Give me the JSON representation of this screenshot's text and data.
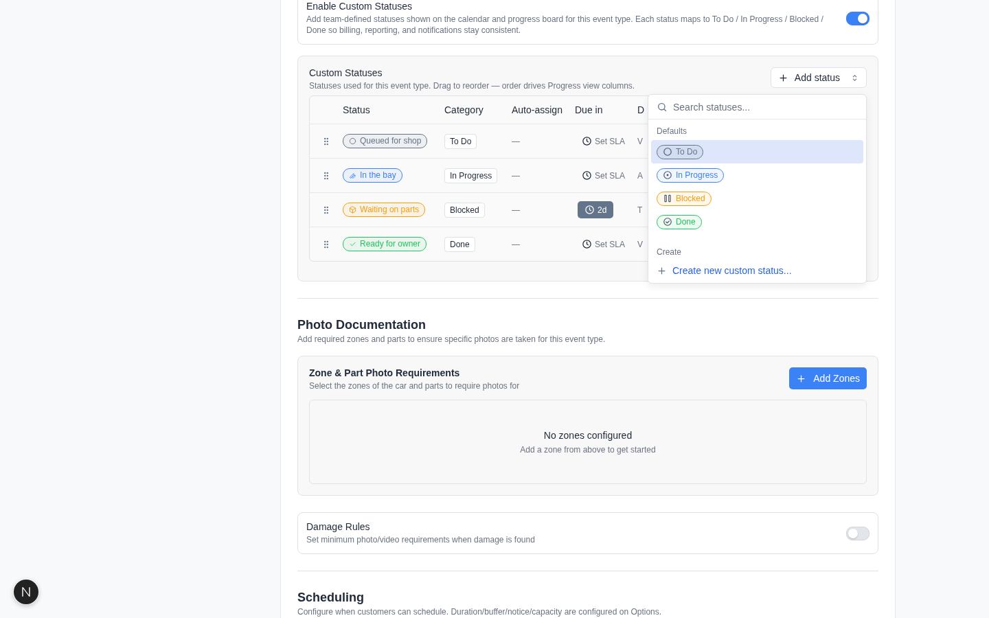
{
  "enable_custom_statuses": {
    "title": "Enable Custom Statuses",
    "description": "Add team-defined statuses shown on the calendar and progress board for this event type. Each status maps to To Do / In Progress / Blocked / Done so billing, reporting, and notifications stay consistent.",
    "on": true
  },
  "custom_statuses": {
    "title": "Custom Statuses",
    "description": "Statuses used for this event type. Drag to reorder — order drives Progress view columns.",
    "add_button": "Add status",
    "columns": [
      "Status",
      "Category",
      "Auto-assign",
      "Due in",
      "D"
    ],
    "rows": [
      {
        "status": {
          "label": "Queued for shop",
          "kind": "circle",
          "color": "#64748b"
        },
        "category": "To Do",
        "auto_assign": "—",
        "due": {
          "text": "Set SLA",
          "set": false
        },
        "column_5": "V"
      },
      {
        "status": {
          "label": "In the bay",
          "kind": "wrench",
          "color": "#3b82f6"
        },
        "category": "In Progress",
        "auto_assign": "—",
        "due": {
          "text": "Set SLA",
          "set": false
        },
        "column_5": "A"
      },
      {
        "status": {
          "label": "Waiting on parts",
          "kind": "package",
          "color": "#f59e0b"
        },
        "category": "Blocked",
        "auto_assign": "—",
        "due": {
          "text": "2d",
          "set": true
        },
        "column_5": "T"
      },
      {
        "status": {
          "label": "Ready for owner",
          "kind": "check",
          "color": "#22c55e"
        },
        "category": "Done",
        "auto_assign": "—",
        "due": {
          "text": "Set SLA",
          "set": false
        },
        "column_5": "V"
      }
    ],
    "dropdown": {
      "search_placeholder": "Search statuses...",
      "groups": [
        {
          "label": "Defaults",
          "items": [
            {
              "label": "To Do",
              "kind": "circle",
              "color": "#64748b",
              "selected": true
            },
            {
              "label": "In Progress",
              "kind": "dot",
              "color": "#3b82f6",
              "selected": false
            },
            {
              "label": "Blocked",
              "kind": "pause",
              "color": "#f59e0b",
              "selected": false
            },
            {
              "label": "Done",
              "kind": "checkcircle",
              "color": "#22c55e",
              "selected": false
            }
          ]
        },
        {
          "label": "Create",
          "action": "Create new custom status..."
        }
      ]
    }
  },
  "photo_documentation": {
    "title": "Photo Documentation",
    "description": "Add required zones and parts to ensure specific photos are taken for this event type.",
    "requirements": {
      "title": "Zone & Part Photo Requirements",
      "description": "Select the zones of the car and parts to require photos for",
      "add_button": "Add Zones",
      "empty_title": "No zones configured",
      "empty_hint": "Add a zone from above to get started"
    }
  },
  "damage_rules": {
    "title": "Damage Rules",
    "description": "Set minimum photo/video requirements when damage is found",
    "on": false
  },
  "scheduling": {
    "title": "Scheduling",
    "description": "Configure when customers can schedule. Duration/buffer/notice/capacity are configured on Options."
  }
}
